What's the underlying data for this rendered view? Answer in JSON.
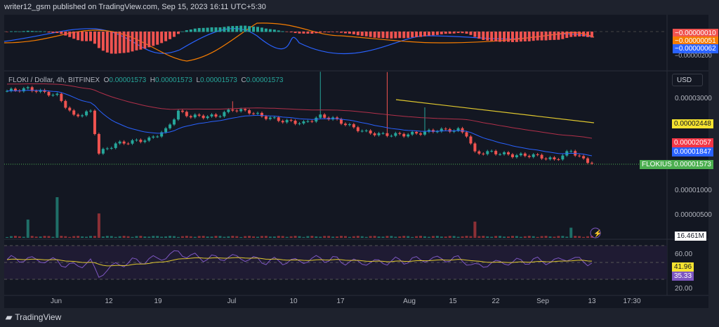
{
  "header": {
    "publisher": "writer12_gsm published on TradingView.com, Sep 15, 2023 16:11 UTC+5:30"
  },
  "legend": {
    "symbol": "FLOKI / Dollar, 4h, BITFINEX",
    "o_label": "O",
    "o": "0.00001573",
    "h_label": "H",
    "h": "0.00001573",
    "l_label": "L",
    "l": "0.00001573",
    "c_label": "C",
    "c": "0.00001573"
  },
  "currency": "USD",
  "macd": {
    "hist": "−0.00000010",
    "signal": "−0.00000051",
    "macd": "−0.00000062",
    "axis": "−0.00000200"
  },
  "price_axis": [
    "0.00003000",
    "0.00001000",
    "0.00000500"
  ],
  "price_labels": {
    "ma_yellow": "0.00002448",
    "ma_red": "0.00002057",
    "ma_blue": "0.00001847",
    "symbol_tag": "FLOKIUSD",
    "last": "0.00001573",
    "volume": "16.461M"
  },
  "rsi": {
    "upper": "60.00",
    "lower": "20.00",
    "ma": "41.96",
    "value": "35.33"
  },
  "time_axis": [
    "Jun",
    "12",
    "19",
    "Jul",
    "10",
    "17",
    "Aug",
    "15",
    "22",
    "Sep",
    "13",
    "17:30"
  ],
  "footer": {
    "brand": "TradingView"
  },
  "colors": {
    "up": "#26a69a",
    "down": "#ef5350",
    "blue": "#2962ff",
    "red": "#b2304a",
    "yellow": "#e0c82e",
    "rsi": "#7e57c2"
  },
  "chart_data": {
    "type": "candlestick",
    "title": "FLOKI / Dollar, 4h, BITFINEX",
    "ylabel": "USD",
    "ylim": [
      0,
      3.6e-05
    ],
    "close_anchors_1e8": [
      [
        0,
        3150
      ],
      [
        5,
        3200
      ],
      [
        12,
        3050
      ],
      [
        16,
        2600
      ],
      [
        20,
        2700
      ],
      [
        22,
        1800
      ],
      [
        26,
        2000
      ],
      [
        34,
        2100
      ],
      [
        38,
        2300
      ],
      [
        41,
        2700
      ],
      [
        44,
        2600
      ],
      [
        50,
        2600
      ],
      [
        54,
        2750
      ],
      [
        58,
        2700
      ],
      [
        61,
        2600
      ],
      [
        66,
        2500
      ],
      [
        71,
        2450
      ],
      [
        75,
        2600
      ],
      [
        78,
        2550
      ],
      [
        83,
        2350
      ],
      [
        86,
        2250
      ],
      [
        90,
        2200
      ],
      [
        95,
        2200
      ],
      [
        100,
        2250
      ],
      [
        103,
        2300
      ],
      [
        108,
        2300
      ],
      [
        110,
        2200
      ],
      [
        112,
        1800
      ],
      [
        116,
        1820
      ],
      [
        121,
        1750
      ],
      [
        126,
        1750
      ],
      [
        131,
        1650
      ],
      [
        135,
        1850
      ],
      [
        138,
        1650
      ],
      [
        140,
        1573
      ]
    ],
    "volume_spikes": [
      [
        5,
        0.45
      ],
      [
        12,
        1.0
      ],
      [
        22,
        0.6
      ],
      [
        112,
        0.4
      ],
      [
        135,
        0.25
      ]
    ]
  }
}
